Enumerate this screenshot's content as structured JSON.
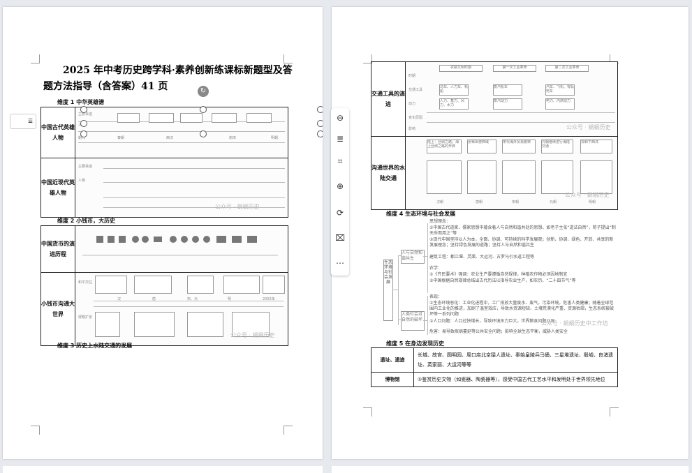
{
  "page1": {
    "title_line1": "2025 年中考历史跨学科·素养创新练课标新题型及答",
    "title_line2": "题方法指导（含答案）41 页",
    "section1": "维度 1 中华英雄谱",
    "section2": "维度 2 小钱币，大历史",
    "section3": "维度 3 历史上水陆交通的发展",
    "table1": {
      "row1_head": "中国古代英雄人物",
      "row2_head": "中国近现代英雄人物",
      "row1_labels": [
        "主要事迹",
        "人物",
        "朝代",
        "秦朝",
        "西汉",
        "南宋",
        "明朝"
      ],
      "row2_labels": [
        "主要事迹",
        "人物"
      ]
    },
    "table2": {
      "row1_head": "中国货币的演进历程",
      "row2_head": "小钱币沟通大世界",
      "row2_labels": [
        "和平交往",
        "侵略扩张",
        "汉",
        "唐",
        "宋、元",
        "明",
        "2002年"
      ]
    },
    "watermark": "公众号 · 蜗蜗历史"
  },
  "page2": {
    "table1": {
      "row1_head": "交通工具的演进",
      "row2_head": "沟通世界的水陆交通",
      "row1_labels": [
        "农耕文明时期",
        "第一次工业革命",
        "第二次工业革命",
        "时期",
        "交通工具",
        "动力",
        "变化原因",
        "影响"
      ],
      "row1_boxes": [
        "马车、人力车、帆船",
        "蒸汽机车",
        "汽车、飞机、有轨电车",
        "人力、畜力、风力、水力",
        "蒸汽动力",
        "电力、内燃动力"
      ],
      "row2_labels": [
        "汉朝",
        "唐朝",
        "宋朝",
        "元朝",
        "明朝"
      ],
      "row2_boxes": [
        "陆上：丝绸之路；海上丝绸之路的开辟",
        "张骞出使西域",
        "宋代海外贸易繁荣",
        "元朝继续进行海陆交通",
        "郑和下西洋"
      ]
    },
    "section4": "维度 4 生态环境与社会发展",
    "mindmap": {
      "root": "生态环境与社会发展",
      "branch1": "人与自然和谐共生",
      "branch2": "人类社会对自然的破坏",
      "b1_items": [
        "思想理念：",
        "①中国古代道家、儒家思想中蕴含着人与自然和谐共处的思想。如老子主张“道法自然”，荀子提出“制天命而用之”等",
        "②现代中国坚持以人为本，全面、协调、可持续的科学发展观；创新、协调、绿色、开放、共享的新发展理念；坚持绿色发展的道路；坚持人与自然和谐共生",
        "建筑工程：都江堰、灵渠、大运河、古罗马引水道工程等",
        "农学：",
        "①《齐民要术》强调：农业生产要遵循自然规律，种植农作物必须因地制宜",
        "②中国根据自然规律总结出古代历法以指导农业生产，如农历、“二十四节气”等"
      ],
      "b2_items": [
        "表现：",
        "①生态环境恶化：工业化进程中，工厂排放大量废水、废气，污染环境，危害人类健康；随着全球范围内工业化的推进，加剧了温室效应，导致水资源短缺、土壤荒漠化严重、资源枯竭，生态系统被破坏等一系列问题",
        "②人口问题：人口过快增长，导致环境压力巨大，世界粮食问题凸显",
        "危害：易导致疾病蔓延等公共安全问题；影响全球生态平衡，威胁人类安全"
      ]
    },
    "section5": "维度 5 在身边发现历史",
    "table4": {
      "r1_head": "遗址、遗迹",
      "r1_text": "长城、故宫、圆明园、周口店北京猿人遗址、秦始皇陵兵马俑、三星堆遗址、殷墟、良渚遗址、英家丽、大运河等等",
      "r2_head": "博物馆",
      "r2_text": "①鉴赏历史文物（如瓷器、陶瓷器等），感受中国古代工艺水平和发明处于世界领先地位"
    },
    "watermark": "公众号 · 蜗蜗历史",
    "watermark2": "公众号 · 蜗蜗历史中工作坊"
  },
  "toolbar": {
    "items": [
      "minus-circle",
      "align",
      "crop",
      "zoom-in",
      "rotate",
      "fit",
      "more"
    ],
    "layout_label": "☰"
  }
}
